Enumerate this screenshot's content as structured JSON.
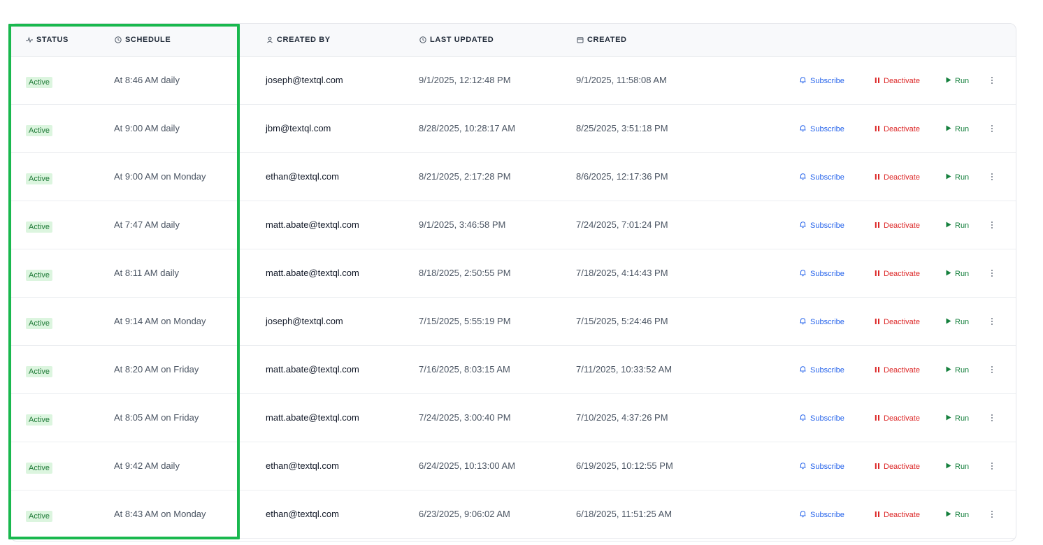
{
  "columns": {
    "status": "STATUS",
    "schedule": "SCHEDULE",
    "created_by": "CREATED BY",
    "last_updated": "LAST UPDATED",
    "created": "CREATED"
  },
  "actions": {
    "subscribe": "Subscribe",
    "deactivate": "Deactivate",
    "run": "Run"
  },
  "rows": [
    {
      "status": "Active",
      "schedule": "At 8:46 AM daily",
      "created_by": "joseph@textql.com",
      "last_updated": "9/1/2025, 12:12:48 PM",
      "created": "9/1/2025, 11:58:08 AM"
    },
    {
      "status": "Active",
      "schedule": "At 9:00 AM daily",
      "created_by": "jbm@textql.com",
      "last_updated": "8/28/2025, 10:28:17 AM",
      "created": "8/25/2025, 3:51:18 PM"
    },
    {
      "status": "Active",
      "schedule": "At 9:00 AM on Monday",
      "created_by": "ethan@textql.com",
      "last_updated": "8/21/2025, 2:17:28 PM",
      "created": "8/6/2025, 12:17:36 PM"
    },
    {
      "status": "Active",
      "schedule": "At 7:47 AM daily",
      "created_by": "matt.abate@textql.com",
      "last_updated": "9/1/2025, 3:46:58 PM",
      "created": "7/24/2025, 7:01:24 PM"
    },
    {
      "status": "Active",
      "schedule": "At 8:11 AM daily",
      "created_by": "matt.abate@textql.com",
      "last_updated": "8/18/2025, 2:50:55 PM",
      "created": "7/18/2025, 4:14:43 PM"
    },
    {
      "status": "Active",
      "schedule": "At 9:14 AM on Monday",
      "created_by": "joseph@textql.com",
      "last_updated": "7/15/2025, 5:55:19 PM",
      "created": "7/15/2025, 5:24:46 PM"
    },
    {
      "status": "Active",
      "schedule": "At 8:20 AM on Friday",
      "created_by": "matt.abate@textql.com",
      "last_updated": "7/16/2025, 8:03:15 AM",
      "created": "7/11/2025, 10:33:52 AM"
    },
    {
      "status": "Active",
      "schedule": "At 8:05 AM on Friday",
      "created_by": "matt.abate@textql.com",
      "last_updated": "7/24/2025, 3:00:40 PM",
      "created": "7/10/2025, 4:37:26 PM"
    },
    {
      "status": "Active",
      "schedule": "At 9:42 AM daily",
      "created_by": "ethan@textql.com",
      "last_updated": "6/24/2025, 10:13:00 AM",
      "created": "6/19/2025, 10:12:55 PM"
    },
    {
      "status": "Active",
      "schedule": "At 8:43 AM on Monday",
      "created_by": "ethan@textql.com",
      "last_updated": "6/23/2025, 9:06:02 AM",
      "created": "6/18/2025, 11:51:25 AM"
    }
  ],
  "icons": {
    "status": "activity-icon",
    "schedule": "clock-icon",
    "created_by": "user-icon",
    "last_updated": "clock-icon",
    "created": "calendar-icon",
    "subscribe": "bell-icon",
    "deactivate": "pause-icon",
    "run": "play-icon",
    "more": "more-vertical-icon"
  },
  "colors": {
    "highlight": "#19b84e",
    "active_badge_bg": "#dcf5df",
    "active_badge_text": "#1f7a37",
    "subscribe": "#2563eb",
    "deactivate": "#dc2626",
    "run": "#15803d"
  }
}
